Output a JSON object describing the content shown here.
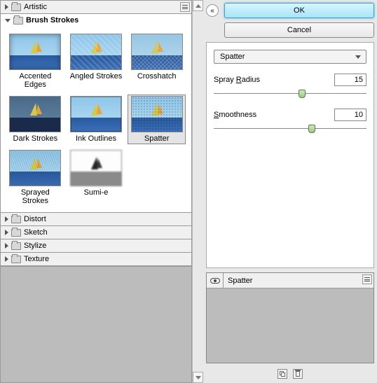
{
  "categories": {
    "artistic": "Artistic",
    "brush_strokes": "Brush Strokes",
    "distort": "Distort",
    "sketch": "Sketch",
    "stylize": "Stylize",
    "texture": "Texture"
  },
  "filters": [
    {
      "label": "Accented Edges",
      "fx": "fx-accented"
    },
    {
      "label": "Angled Strokes",
      "fx": "fx-angled"
    },
    {
      "label": "Crosshatch",
      "fx": "fx-cross"
    },
    {
      "label": "Dark Strokes",
      "fx": "fx-dark"
    },
    {
      "label": "Ink Outlines",
      "fx": "fx-ink"
    },
    {
      "label": "Spatter",
      "fx": "fx-spatter",
      "selected": true
    },
    {
      "label": "Sprayed Strokes",
      "fx": "fx-spray"
    },
    {
      "label": "Sumi-e",
      "fx": "fx-sumi"
    }
  ],
  "buttons": {
    "ok": "OK",
    "cancel": "Cancel"
  },
  "current_filter": "Spatter",
  "params": {
    "spray_radius": {
      "label_pre": "Spray ",
      "label_u": "R",
      "label_post": "adius",
      "value": "15",
      "pct": 58
    },
    "smoothness": {
      "label_pre": "",
      "label_u": "S",
      "label_post": "moothness",
      "value": "10",
      "pct": 64
    }
  },
  "layer": {
    "name": "Spatter"
  }
}
